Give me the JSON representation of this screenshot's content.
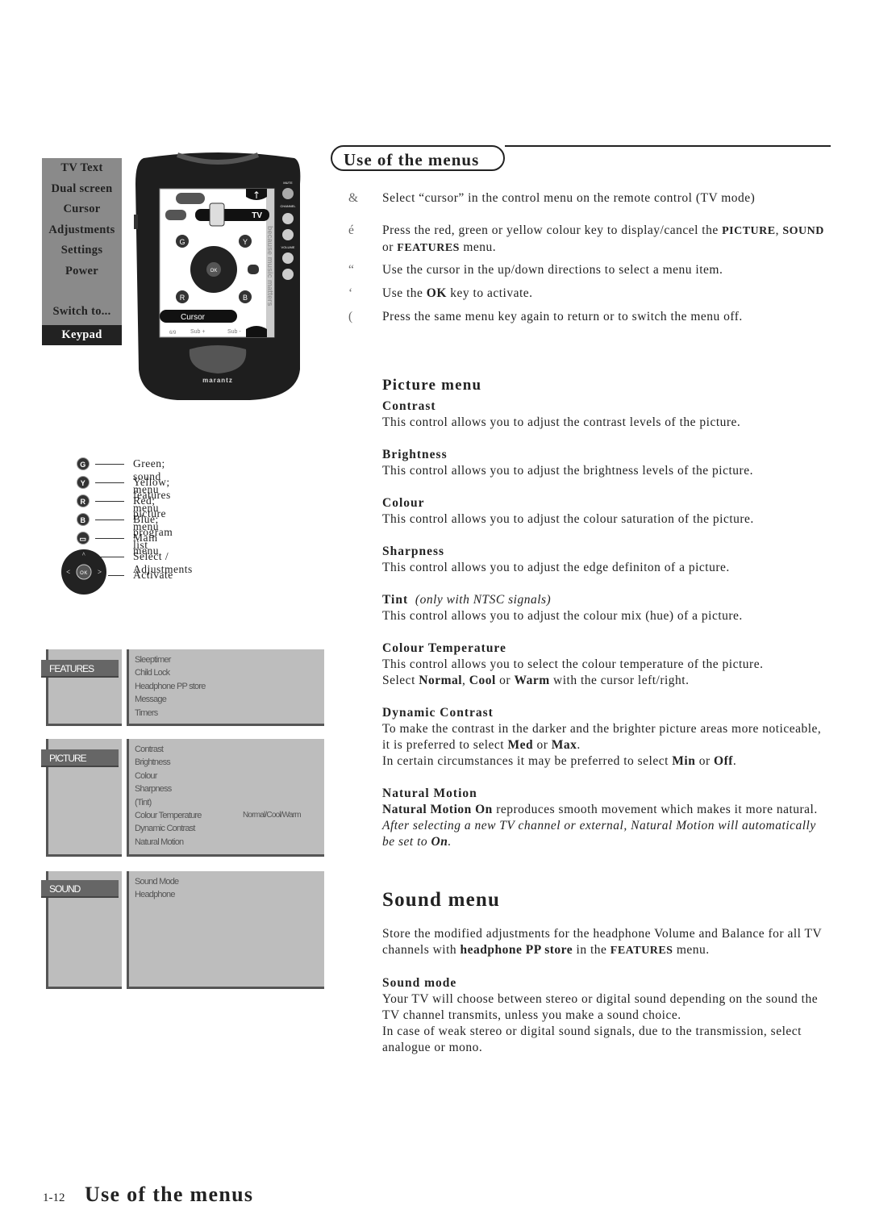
{
  "side_menu": {
    "items": [
      "TV Text",
      "Dual screen",
      "Cursor",
      "Adjustments",
      "Settings",
      "Power",
      "Switch to..."
    ],
    "selected": "Keypad"
  },
  "remote": {
    "screen_label_tv": "TV",
    "screen_label_cursor": "Cursor",
    "side_text": "because music matters",
    "labels": {
      "mute": "MUTE",
      "channel": "CHANNEL",
      "volume": "VOLUME"
    },
    "bottom_bar": [
      "6/9",
      "Sub +",
      "Sub -"
    ],
    "brand": "marantz",
    "keys": [
      "G",
      "Y",
      "R",
      "B",
      "OK"
    ]
  },
  "legend": [
    {
      "icon": "G",
      "label": "Green; sound menu"
    },
    {
      "icon": "Y",
      "label": "Yellow; features menu"
    },
    {
      "icon": "R",
      "label": "Red; picture menu"
    },
    {
      "icon": "B",
      "label": "Blue; program list"
    },
    {
      "icon": "menu-icon",
      "label": "Main menu"
    },
    {
      "icon": "cursor-pad-icon",
      "label": "Select / Adjustments"
    },
    {
      "icon": "OK",
      "label": "Activate"
    }
  ],
  "menus": {
    "features": {
      "tab": "FEATURES",
      "items": [
        "Sleeptimer",
        "Child Lock",
        "Headphone PP store",
        "Message",
        "Timers"
      ]
    },
    "picture": {
      "tab": "PICTURE",
      "items": [
        "Contrast",
        "Brightness",
        "Colour",
        "Sharpness",
        "(Tint)",
        "Colour Temperature",
        "Dynamic Contrast",
        "Natural Motion"
      ],
      "colour_temp_value": "Normal/Cool/Warm"
    },
    "sound": {
      "tab": "SOUND",
      "items": [
        "Sound Mode",
        "Headphone"
      ]
    }
  },
  "section_title": "Use of the menus",
  "steps": [
    {
      "bullet": "&",
      "text": "Select “cursor” in the control menu on the remote control (TV mode)"
    },
    {
      "bullet": "é",
      "pre": "Press the red, green or yellow colour key to display/cancel the ",
      "k1": "PICTURE",
      "mid1": ", ",
      "k2": "SOUND",
      "mid2": " or ",
      "k3": "FEATURES",
      "post": " menu."
    },
    {
      "bullet": "“",
      "text": "Use the cursor in the up/down directions to select a menu item."
    },
    {
      "bullet": "‘",
      "pre": "Use the ",
      "k1": "OK",
      "post": " key to activate."
    },
    {
      "bullet": "(",
      "text": "Press the same menu key again to return or to switch the menu off."
    }
  ],
  "picture_menu": {
    "title": "Picture menu",
    "contrast": {
      "h": "Contrast",
      "t": "This control allows you to adjust the contrast levels of the picture."
    },
    "brightness": {
      "h": "Brightness",
      "t": "This control allows you to adjust the brightness levels of the picture."
    },
    "colour": {
      "h": "Colour",
      "t": "This control allows you to adjust the colour saturation of the picture."
    },
    "sharpness": {
      "h": "Sharpness",
      "t": "This control allows you to adjust the edge definiton of a picture."
    },
    "tint": {
      "h": "Tint",
      "note": "(only with NTSC signals)",
      "t": "This control allows you to adjust the colour mix (hue) of a picture."
    },
    "colour_temp": {
      "h": "Colour Temperature",
      "t": "This control allows you to select the colour temperature of the picture.",
      "t2a": "Select ",
      "normal": "Normal",
      "c1": ", ",
      "cool": "Cool",
      "c2": " or ",
      "warm": "Warm",
      "t2b": " with the cursor left/right."
    },
    "dynamic": {
      "h": "Dynamic Contrast",
      "t": "To make the contrast in the darker and the brighter picture areas more noticeable, it is preferred to select ",
      "med": "Med",
      "or": " or ",
      "max": "Max",
      "dot": ".",
      "t2": "In certain circumstances it may be preferred to select ",
      "min": "Min",
      "or2": " or ",
      "off": "Off",
      "dot2": "."
    },
    "natural": {
      "h": "Natural Motion",
      "b": "Natural Motion On",
      "t": " reproduces smooth movement which makes it more natural.",
      "i": "After selecting a new TV channel or external, Natural Motion will automatically be set to ",
      "on": "On",
      "dot": "."
    }
  },
  "sound_menu": {
    "title": "Sound menu",
    "intro_a": "Store the modified adjustments for the headphone Volume and Balance for all TV channels with ",
    "intro_b": "headphone PP store",
    "intro_c": " in the ",
    "intro_d": "FEATURES",
    "intro_e": " menu.",
    "mode": {
      "h": "Sound mode",
      "t": "Your TV will choose between stereo or digital sound depending on the sound the TV channel transmits, unless you make a sound choice.",
      "t2": "In case of weak stereo or digital sound signals, due to the transmission, select analogue or mono."
    }
  },
  "footer": {
    "page": "1-12",
    "title": "Use of the menus"
  }
}
